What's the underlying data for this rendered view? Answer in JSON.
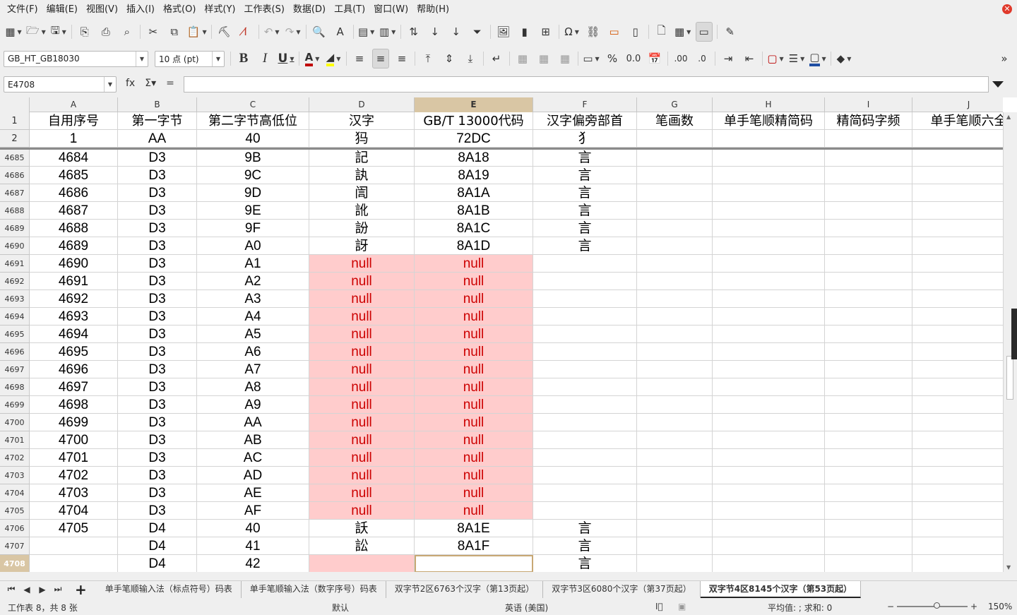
{
  "menu": [
    "文件(F)",
    "编辑(E)",
    "视图(V)",
    "插入(I)",
    "格式(O)",
    "样式(Y)",
    "工作表(S)",
    "数据(D)",
    "工具(T)",
    "窗口(W)",
    "帮助(H)"
  ],
  "toolbar2": {
    "font_name": "GB_HT_GB18030",
    "font_size": "10 点 (pt)",
    "bold": "B",
    "italic": "I",
    "underline": "U"
  },
  "formula": {
    "cell_ref": "E4708",
    "value": "",
    "eq": "="
  },
  "columns": [
    "A",
    "B",
    "C",
    "D",
    "E",
    "F",
    "G",
    "H",
    "I",
    "J"
  ],
  "header_row": [
    "自用序号",
    "第一字节",
    "第二字节高低位",
    "汉字",
    "GB/T  13000代码",
    "汉字偏旁部首",
    "笔画数",
    "单手笔顺精简码",
    "精简码字频",
    "单手笔顺六全"
  ],
  "rows": [
    {
      "n": "2",
      "A": "1",
      "B": "AA",
      "C": "40",
      "D": "犸",
      "E": "72DC",
      "F": "犭"
    },
    {
      "n": "4685",
      "A": "4684",
      "B": "D3",
      "C": "9B",
      "D": "記",
      "E": "8A18",
      "F": "言"
    },
    {
      "n": "4686",
      "A": "4685",
      "B": "D3",
      "C": "9C",
      "D": "訙",
      "E": "8A19",
      "F": "言"
    },
    {
      "n": "4687",
      "A": "4686",
      "B": "D3",
      "C": "9D",
      "D": "訚",
      "E": "8A1A",
      "F": "言"
    },
    {
      "n": "4688",
      "A": "4687",
      "B": "D3",
      "C": "9E",
      "D": "訛",
      "E": "8A1B",
      "F": "言"
    },
    {
      "n": "4689",
      "A": "4688",
      "B": "D3",
      "C": "9F",
      "D": "訜",
      "E": "8A1C",
      "F": "言"
    },
    {
      "n": "4690",
      "A": "4689",
      "B": "D3",
      "C": "A0",
      "D": "訝",
      "E": "8A1D",
      "F": "言"
    },
    {
      "n": "4691",
      "A": "4690",
      "B": "D3",
      "C": "A1",
      "D": "null",
      "E": "null",
      "F": ""
    },
    {
      "n": "4692",
      "A": "4691",
      "B": "D3",
      "C": "A2",
      "D": "null",
      "E": "null",
      "F": ""
    },
    {
      "n": "4693",
      "A": "4692",
      "B": "D3",
      "C": "A3",
      "D": "null",
      "E": "null",
      "F": ""
    },
    {
      "n": "4694",
      "A": "4693",
      "B": "D3",
      "C": "A4",
      "D": "null",
      "E": "null",
      "F": ""
    },
    {
      "n": "4695",
      "A": "4694",
      "B": "D3",
      "C": "A5",
      "D": "null",
      "E": "null",
      "F": ""
    },
    {
      "n": "4696",
      "A": "4695",
      "B": "D3",
      "C": "A6",
      "D": "null",
      "E": "null",
      "F": ""
    },
    {
      "n": "4697",
      "A": "4696",
      "B": "D3",
      "C": "A7",
      "D": "null",
      "E": "null",
      "F": ""
    },
    {
      "n": "4698",
      "A": "4697",
      "B": "D3",
      "C": "A8",
      "D": "null",
      "E": "null",
      "F": ""
    },
    {
      "n": "4699",
      "A": "4698",
      "B": "D3",
      "C": "A9",
      "D": "null",
      "E": "null",
      "F": ""
    },
    {
      "n": "4700",
      "A": "4699",
      "B": "D3",
      "C": "AA",
      "D": "null",
      "E": "null",
      "F": ""
    },
    {
      "n": "4701",
      "A": "4700",
      "B": "D3",
      "C": "AB",
      "D": "null",
      "E": "null",
      "F": ""
    },
    {
      "n": "4702",
      "A": "4701",
      "B": "D3",
      "C": "AC",
      "D": "null",
      "E": "null",
      "F": ""
    },
    {
      "n": "4703",
      "A": "4702",
      "B": "D3",
      "C": "AD",
      "D": "null",
      "E": "null",
      "F": ""
    },
    {
      "n": "4704",
      "A": "4703",
      "B": "D3",
      "C": "AE",
      "D": "null",
      "E": "null",
      "F": ""
    },
    {
      "n": "4705",
      "A": "4704",
      "B": "D3",
      "C": "AF",
      "D": "null",
      "E": "null",
      "F": ""
    },
    {
      "n": "4706",
      "A": "4705",
      "B": "D4",
      "C": "40",
      "D": "訞",
      "E": "8A1E",
      "F": "言"
    },
    {
      "n": "4707",
      "A": "",
      "B": "D4",
      "C": "41",
      "D": "訟",
      "E": "8A1F",
      "F": "言"
    },
    {
      "n": "4708",
      "A": "",
      "B": "D4",
      "C": "42",
      "D": "",
      "E": "",
      "F": "言"
    }
  ],
  "sheet_tabs": [
    "单手笔顺输入法（标点符号）码表",
    "单手笔顺输入法（数字序号）码表",
    "双字节2区6763个汉字（第13页起）",
    "双字节3区6080个汉字（第37页起）",
    "双字节4区8145个汉字（第53页起）"
  ],
  "active_tab": 4,
  "status": {
    "sheet": "工作表 8，共 8 张",
    "style": "默认",
    "lang": "英语 (美国)",
    "summary": "平均值: ; 求和: 0",
    "zoom": "150%",
    "minus": "−",
    "plus": "+"
  },
  "colors": {
    "selected_header": "#d9c6a4",
    "null_fill": "#ffcccc",
    "null_text": "#cc0000"
  }
}
